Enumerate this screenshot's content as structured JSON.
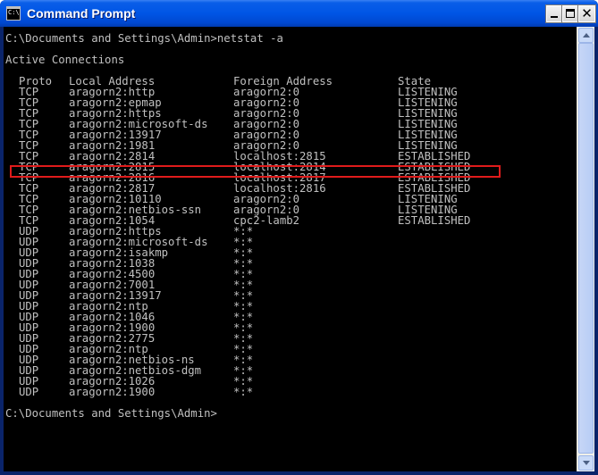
{
  "window": {
    "title": "Command Prompt",
    "icon": "cmd-icon",
    "icon_text": "C:\\"
  },
  "console": {
    "command_line": "C:\\Documents and Settings\\Admin>netstat -a",
    "section_title": "Active Connections",
    "headers": [
      "Proto",
      "Local Address",
      "Foreign Address",
      "State"
    ],
    "rows": [
      [
        "TCP",
        "aragorn2:http",
        "aragorn2:0",
        "LISTENING"
      ],
      [
        "TCP",
        "aragorn2:epmap",
        "aragorn2:0",
        "LISTENING"
      ],
      [
        "TCP",
        "aragorn2:https",
        "aragorn2:0",
        "LISTENING"
      ],
      [
        "TCP",
        "aragorn2:microsoft-ds",
        "aragorn2:0",
        "LISTENING"
      ],
      [
        "TCP",
        "aragorn2:13917",
        "aragorn2:0",
        "LISTENING"
      ],
      [
        "TCP",
        "aragorn2:1981",
        "aragorn2:0",
        "LISTENING"
      ],
      [
        "TCP",
        "aragorn2:2814",
        "localhost:2815",
        "ESTABLISHED"
      ],
      [
        "TCP",
        "aragorn2:2815",
        "localhost:2814",
        "ESTABLISHED"
      ],
      [
        "TCP",
        "aragorn2:2816",
        "localhost:2817",
        "ESTABLISHED"
      ],
      [
        "TCP",
        "aragorn2:2817",
        "localhost:2816",
        "ESTABLISHED"
      ],
      [
        "TCP",
        "aragorn2:10110",
        "aragorn2:0",
        "LISTENING"
      ],
      [
        "TCP",
        "aragorn2:netbios-ssn",
        "aragorn2:0",
        "LISTENING"
      ],
      [
        "TCP",
        "aragorn2:1054",
        "cpc2-lamb2",
        "ESTABLISHED"
      ],
      [
        "UDP",
        "aragorn2:https",
        "*:*",
        ""
      ],
      [
        "UDP",
        "aragorn2:microsoft-ds",
        "*:*",
        ""
      ],
      [
        "UDP",
        "aragorn2:isakmp",
        "*:*",
        ""
      ],
      [
        "UDP",
        "aragorn2:1038",
        "*:*",
        ""
      ],
      [
        "UDP",
        "aragorn2:4500",
        "*:*",
        ""
      ],
      [
        "UDP",
        "aragorn2:7001",
        "*:*",
        ""
      ],
      [
        "UDP",
        "aragorn2:13917",
        "*:*",
        ""
      ],
      [
        "UDP",
        "aragorn2:ntp",
        "*:*",
        ""
      ],
      [
        "UDP",
        "aragorn2:1046",
        "*:*",
        ""
      ],
      [
        "UDP",
        "aragorn2:1900",
        "*:*",
        ""
      ],
      [
        "UDP",
        "aragorn2:2775",
        "*:*",
        ""
      ],
      [
        "UDP",
        "aragorn2:ntp",
        "*:*",
        ""
      ],
      [
        "UDP",
        "aragorn2:netbios-ns",
        "*:*",
        ""
      ],
      [
        "UDP",
        "aragorn2:netbios-dgm",
        "*:*",
        ""
      ],
      [
        "UDP",
        "aragorn2:1026",
        "*:*",
        ""
      ],
      [
        "UDP",
        "aragorn2:1900",
        "*:*",
        ""
      ]
    ],
    "highlighted_row_index": 5,
    "prompt_line": "C:\\Documents and Settings\\Admin>",
    "text_color": "#c0c0c0",
    "background_color": "#000000",
    "highlight_color": "#e01b1b"
  }
}
